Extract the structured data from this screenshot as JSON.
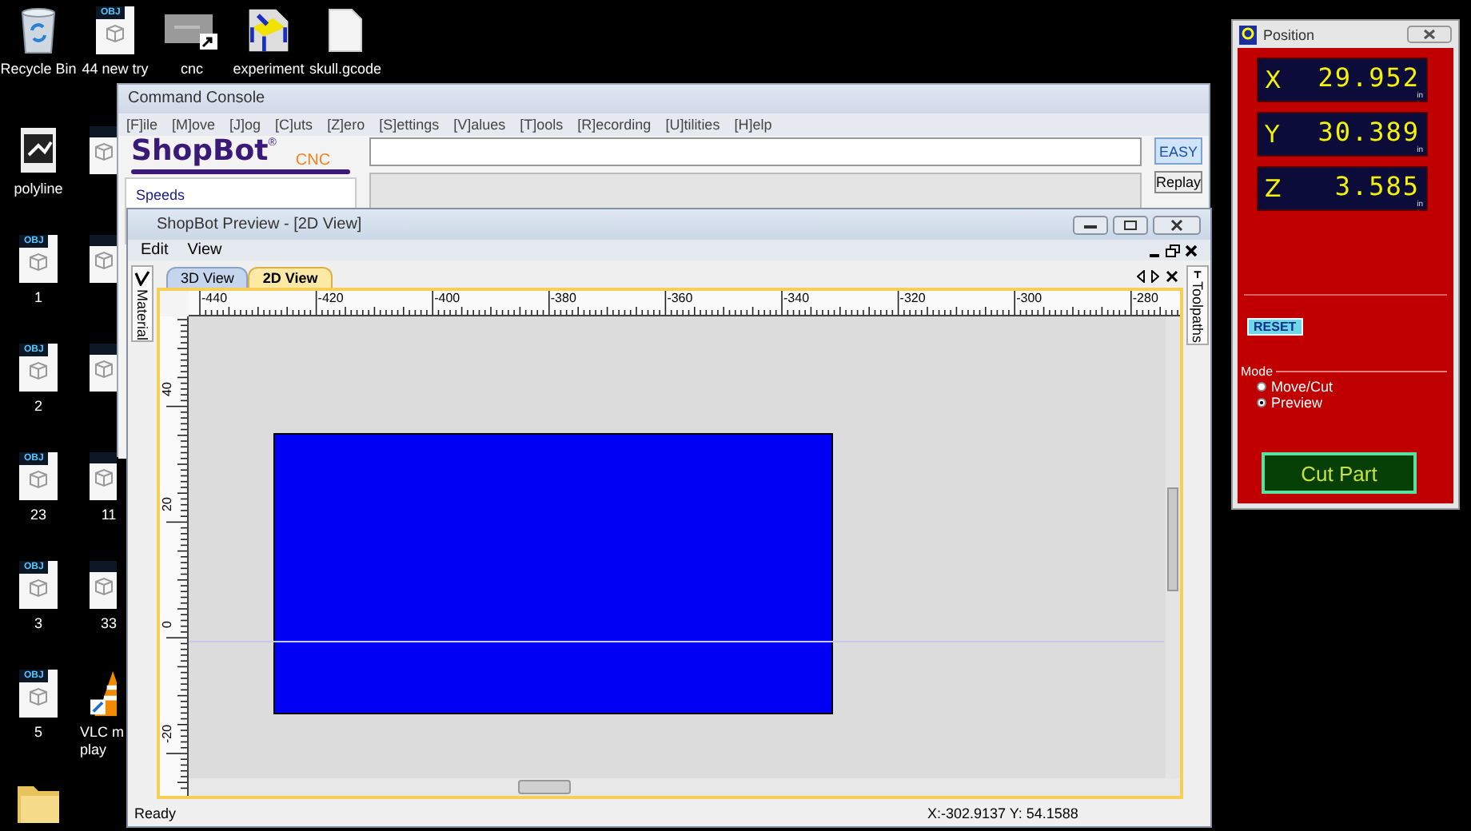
{
  "desktop": {
    "top_row": [
      {
        "label": "Recycle Bin",
        "kind": "recycle"
      },
      {
        "label": "44 new try",
        "kind": "obj",
        "badge": "OBJ"
      },
      {
        "label": "cnc",
        "kind": "shortcut"
      },
      {
        "label": "experiment",
        "kind": "app"
      },
      {
        "label": "skull.gcode",
        "kind": "file"
      }
    ],
    "columns": [
      [
        {
          "label": "polyline",
          "kind": "image"
        },
        {
          "label": "1",
          "kind": "obj",
          "badge": "OBJ"
        },
        {
          "label": "2",
          "kind": "obj",
          "badge": "OBJ"
        },
        {
          "label": "23",
          "kind": "obj",
          "badge": "OBJ"
        },
        {
          "label": "3",
          "kind": "obj",
          "badge": "OBJ"
        },
        {
          "label": "5",
          "kind": "obj",
          "badge": "OBJ"
        },
        {
          "kind": "folder"
        }
      ],
      [
        {
          "kind": "obj"
        },
        {
          "kind": "obj"
        },
        {
          "kind": "obj"
        },
        {
          "label": "11",
          "kind": "obj"
        },
        {
          "label": "33",
          "kind": "obj"
        },
        {
          "label": "VLC m\nplay",
          "kind": "vlc"
        }
      ]
    ]
  },
  "command_console": {
    "title": "Command Console",
    "menu": [
      "[F]ile",
      "[M]ove",
      "[J]og",
      "[C]uts",
      "[Z]ero",
      "[S]ettings",
      "[V]alues",
      "[T]ools",
      "[R]ecording",
      "[U]tilities",
      "[H]elp"
    ],
    "logo": {
      "name": "ShopBot",
      "mark": "®",
      "suffix": "CNC"
    },
    "easy_button": "EASY",
    "side_buttons": [
      "Replay"
    ],
    "speeds_label": "Speeds"
  },
  "preview": {
    "title": "ShopBot Preview - [2D View]",
    "menu": [
      "Edit",
      "View"
    ],
    "left_panel_tab": "Material",
    "right_panel_tab": "Toolpaths",
    "tabs": [
      {
        "label": "3D View",
        "selected": false
      },
      {
        "label": "2D View",
        "selected": true
      }
    ],
    "x_ruler": [
      "-440",
      "-420",
      "-400",
      "-380",
      "-360",
      "-340",
      "-320",
      "-300",
      "-280"
    ],
    "y_ruler": [
      "40",
      "20",
      "0",
      "-20"
    ],
    "status": "Ready",
    "coordinates": "X:-302.9137 Y: 54.1588"
  },
  "position": {
    "title": "Position",
    "axes": [
      {
        "axis": "X",
        "value": "29.952",
        "unit": "in"
      },
      {
        "axis": "Y",
        "value": "30.389",
        "unit": "in"
      },
      {
        "axis": "Z",
        "value": "3.585",
        "unit": "in"
      }
    ],
    "reset_button": "RESET",
    "mode_label": "Mode",
    "modes": [
      {
        "label": "Move/Cut",
        "selected": false
      },
      {
        "label": "Preview",
        "selected": true
      }
    ],
    "cut_button": "Cut Part"
  }
}
